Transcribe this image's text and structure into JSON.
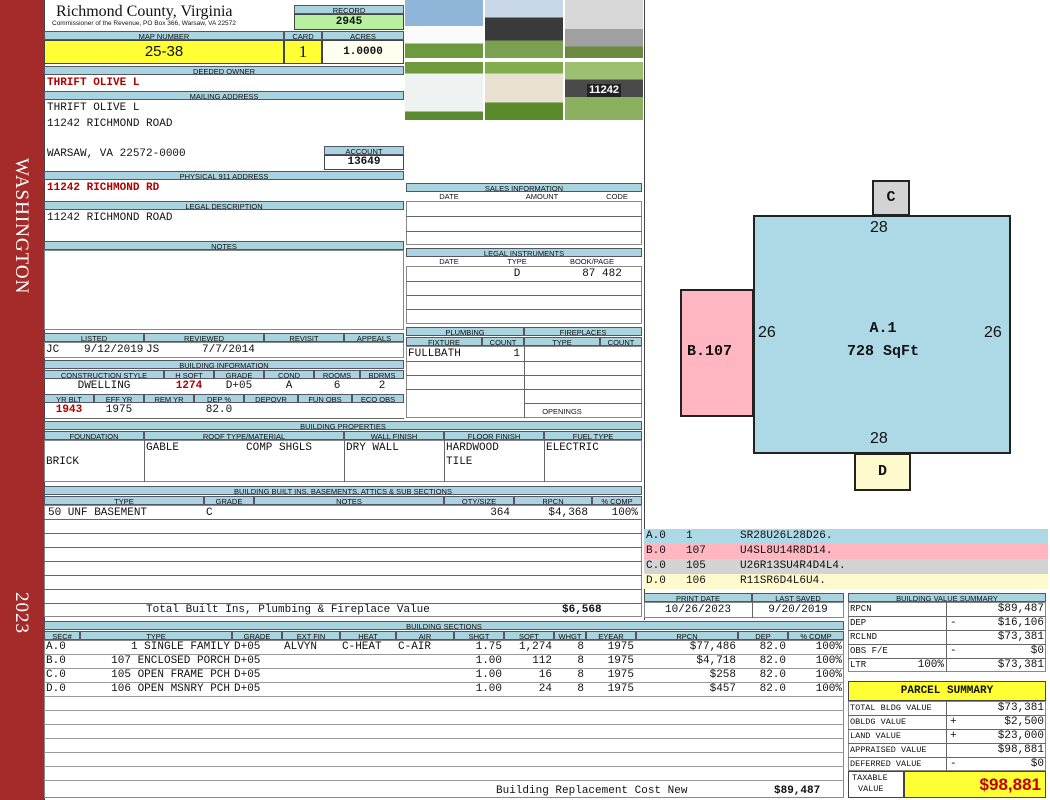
{
  "sidebar": {
    "county_word": "WASHINGTON",
    "year": "2023"
  },
  "header": {
    "county": "Richmond County, Virginia",
    "commissioner": "Commissioner of the Revenue, PO Box 366, Warsaw, VA 22572",
    "record_label": "RECORD",
    "record": "2945",
    "map_label": "MAP NUMBER",
    "map": "25-38",
    "card_label": "CARD",
    "card": "1",
    "acres_label": "ACRES",
    "acres": "1.0000"
  },
  "owner": {
    "deeded_label": "DEEDED OWNER",
    "deeded": "THRIFT OLIVE L",
    "mailing_label": "MAILING ADDRESS",
    "mail1": "THRIFT OLIVE L",
    "mail2": "11242 RICHMOND ROAD",
    "mail3": "WARSAW, VA 22572-0000",
    "account_label": "ACCOUNT",
    "account": "13649",
    "phys_label": "PHYSICAL 911 ADDRESS",
    "phys": "11242 RICHMOND RD",
    "legal_label": "LEGAL DESCRIPTION",
    "legal": "11242 RICHMOND ROAD",
    "notes_label": "NOTES"
  },
  "photos": [
    {
      "name": "house-photo-1"
    },
    {
      "name": "garage-photo"
    },
    {
      "name": "shed-photo-1"
    },
    {
      "name": "shed-photo-2"
    },
    {
      "name": "house-photo-2"
    },
    {
      "name": "mailbox-photo",
      "text": "11242"
    }
  ],
  "sales": {
    "title": "SALES INFORMATION",
    "cols": [
      "DATE",
      "AMOUNT",
      "CODE"
    ]
  },
  "legal_instruments": {
    "title": "LEGAL INSTRUMENTS",
    "cols": [
      "DATE",
      "TYPE",
      "BOOK/PAGE"
    ],
    "type": "D",
    "bookpage": "87 482"
  },
  "listed": {
    "listed_label": "LISTED",
    "listed_by": "JC",
    "listed_date": "9/12/2019",
    "reviewed_label": "REVIEWED",
    "reviewed_by": "JS",
    "reviewed_date": "7/7/2014",
    "revisit_label": "REVISIT",
    "appeals_label": "APPEALS"
  },
  "building_info": {
    "title": "BUILDING INFORMATION",
    "h_style": "CONSTRUCTION STYLE",
    "h_sqft": "H SQFT",
    "h_grade": "GRADE",
    "h_cond": "COND",
    "h_rooms": "ROOMS",
    "h_bdrms": "BDRMS",
    "style": "DWELLING",
    "sqft": "1274",
    "grade": "D+05",
    "cond": "A",
    "rooms": "6",
    "bdrms": "2",
    "h_yrblt": "YR BLT",
    "h_effyr": "EFF YR",
    "h_remyr": "REM YR",
    "h_dep": "DEP %",
    "h_depovr": "DEPOVR",
    "h_funobs": "FUN OBS",
    "h_ecoobs": "ECO OBS",
    "yrblt": "1943",
    "effyr": "1975",
    "dep": "82.0"
  },
  "plumbing": {
    "title": "PLUMBING",
    "fixture_label": "FIXTURE",
    "count_label": "COUNT",
    "fixture": "FULLBATH",
    "count": "1"
  },
  "fireplaces": {
    "title": "FIREPLACES",
    "type_label": "TYPE",
    "count_label": "COUNT",
    "openings_label": "OPENINGS"
  },
  "properties": {
    "title": "BUILDING PROPERTIES",
    "h_found": "FOUNDATION",
    "h_roof": "ROOF TYPE/MATERIAL",
    "h_wall": "WALL FINISH",
    "h_floor": "FLOOR FINISH",
    "h_fuel": "FUEL TYPE",
    "found": "BRICK",
    "roof1": "GABLE",
    "roof2": "COMP SHGLS",
    "wall": "DRY WALL",
    "floor1": "HARDWOOD",
    "floor2": "TILE",
    "fuel": "ELECTRIC"
  },
  "builtins": {
    "title": "BUILDING BUILT INS, BASEMENTS, ATTICS & SUB SECTIONS",
    "cols": [
      "TYPE",
      "GRADE",
      "NOTES",
      "QTY/SIZE",
      "RPCN",
      "% COMP"
    ],
    "rows": [
      [
        "50 UNF BASEMENT",
        "C",
        "",
        "364",
        "$4,368",
        "100%"
      ]
    ],
    "total_label": "Total Built Ins, Plumbing & Fireplace Value",
    "total": "$6,568"
  },
  "sections": {
    "title": "BUILDING SECTIONS",
    "cols": [
      "SEC#",
      "TYPE",
      "GRADE",
      "EXT FIN",
      "HEAT",
      "AIR",
      "SHGT",
      "SQFT",
      "WHGT",
      "EYEAR",
      "RPCN",
      "DEP",
      "% COMP"
    ],
    "rows": [
      [
        "A.0",
        "1 SINGLE FAMILY",
        "D+05",
        "ALVYN",
        "C-HEAT",
        "C-AIR",
        "1.75",
        "1,274",
        "8",
        "1975",
        "$77,486",
        "82.0",
        "100%"
      ],
      [
        "B.0",
        "107 ENCLOSED PORCH",
        "D+05",
        "",
        "",
        "",
        "1.00",
        "112",
        "8",
        "1975",
        "$4,718",
        "82.0",
        "100%"
      ],
      [
        "C.0",
        "105 OPEN FRAME PCH",
        "D+05",
        "",
        "",
        "",
        "1.00",
        "16",
        "8",
        "1975",
        "$258",
        "82.0",
        "100%"
      ],
      [
        "D.0",
        "106 OPEN MSNRY PCH",
        "D+05",
        "",
        "",
        "",
        "1.00",
        "24",
        "8",
        "1975",
        "$457",
        "82.0",
        "100%"
      ]
    ],
    "total_label": "Building Replacement Cost New",
    "total": "$89,487"
  },
  "sketch": {
    "A_label": "A.1",
    "A_area": "728 SqFt",
    "B_label": "B.107",
    "C_label": "C",
    "D_label": "D",
    "top": "28",
    "bottom": "28",
    "left": "26",
    "right": "26",
    "colors": {
      "A": "#add8e6",
      "B": "#ffb6c1",
      "C": "#d3d3d3",
      "D": "#fffacd"
    }
  },
  "vectors": [
    {
      "sec": "A.0",
      "code": "1",
      "vec": "SR28U26L28D26.",
      "color": "#add8e6"
    },
    {
      "sec": "B.0",
      "code": "107",
      "vec": "U4SL8U14R8D14.",
      "color": "#ffb6c1"
    },
    {
      "sec": "C.0",
      "code": "105",
      "vec": "U26R13SU4R4D4L4.",
      "color": "#d3d3d3"
    },
    {
      "sec": "D.0",
      "code": "106",
      "vec": "R11SR6D4L6U4.",
      "color": "#fffacd"
    }
  ],
  "dates": {
    "print_label": "PRINT DATE",
    "print": "10/26/2023",
    "saved_label": "LAST SAVED",
    "saved": "9/20/2019"
  },
  "bvs": {
    "title": "BUILDING VALUE SUMMARY",
    "rpcn": "RPCN",
    "rpcn_v": "$89,487",
    "dep": "DEP",
    "dep_s": "-",
    "dep_v": "$16,106",
    "rclnd": "RCLND",
    "rclnd_v": "$73,381",
    "obs": "OBS F/E",
    "obs_s": "-",
    "obs_v": "$0",
    "ltr": "LTR",
    "ltr_p": "100%",
    "ltr_v": "$73,381"
  },
  "parcel": {
    "title": "PARCEL SUMMARY",
    "bldg_l": "TOTAL BLDG VALUE",
    "bldg_v": "$73,381",
    "obldg_l": "OBLDG VALUE",
    "obldg_s": "+",
    "obldg_v": "$2,500",
    "land_l": "LAND VALUE",
    "land_s": "+",
    "land_v": "$23,000",
    "appr_l": "APPRAISED VALUE",
    "appr_v": "$98,881",
    "def_l": "DEFERRED VALUE",
    "def_s": "-",
    "def_v": "$0",
    "tax_l1": "TAXABLE",
    "tax_l2": "VALUE",
    "tax_v": "$98,881"
  }
}
